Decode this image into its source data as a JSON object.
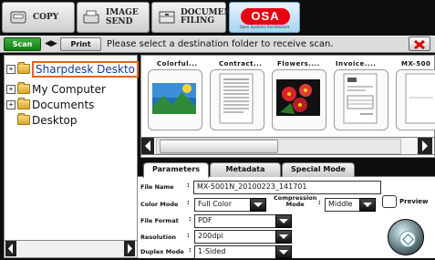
{
  "mode_tabs": [
    {
      "label": "COPY",
      "icon": "copy-icon"
    },
    {
      "label": "IMAGE SEND",
      "icon": "image-send-icon"
    },
    {
      "line1": "DOCUMENT",
      "line2": "FILING",
      "icon": "document-filing-icon"
    }
  ],
  "osa": {
    "logo": "OSA",
    "subtitle": "Open Systems Architecture"
  },
  "toolbar": {
    "scan_label": "Scan",
    "nav_arrows": "◀▶",
    "print_label": "Print",
    "message": "Please select a destination folder to receive scan.",
    "close_label": "X"
  },
  "tree": {
    "items": [
      {
        "label": "Sharpdesk Deskto",
        "expander": "+",
        "selected": true
      },
      {
        "label": "My Computer",
        "expander": "+"
      },
      {
        "label": "Documents",
        "expander": "+"
      },
      {
        "label": "Desktop",
        "expander": ""
      }
    ]
  },
  "thumbnails": [
    {
      "caption": "Colorful..."
    },
    {
      "caption": "Contract..."
    },
    {
      "caption": "Flowers...."
    },
    {
      "caption": "Invoice...."
    },
    {
      "caption": "MX-500"
    }
  ],
  "param_tabs": [
    "Parameters",
    "Metadata",
    "Special Mode"
  ],
  "params": {
    "file_name_label": "File Name",
    "file_name_value": "MX-5001N_20100223_141701",
    "color_mode_label": "Color Mode",
    "color_mode_value": "Full Color",
    "compression_label_1": "Compression",
    "compression_label_2": "Mode",
    "compression_value": "Middle",
    "file_format_label": "File Format",
    "file_format_value": "PDF",
    "resolution_label": "Resolution",
    "resolution_value": "200dpi",
    "duplex_label": "Duplex Mode",
    "duplex_value": "1-Sided",
    "preview_label": "Preview"
  },
  "colors": {
    "accent_green": "#1e8f1e",
    "osa_red": "#e60012",
    "selection_orange": "#e0641f"
  }
}
